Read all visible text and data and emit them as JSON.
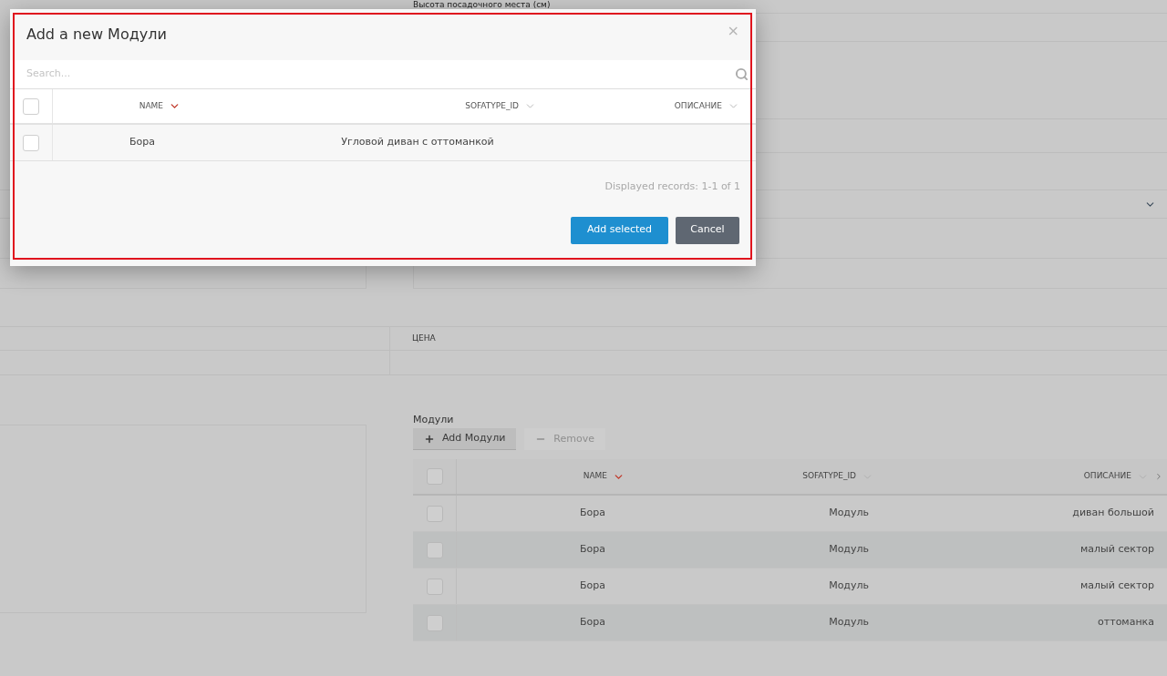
{
  "form": {
    "top_label": "Высота посадочного места (см)",
    "price_column": "ЦЕНА"
  },
  "modules": {
    "label": "Модули",
    "buttons": [
      {
        "kind": "add",
        "label": "Add Модули",
        "disabled": false
      },
      {
        "kind": "remove",
        "label": "Remove",
        "disabled": true
      }
    ],
    "select_all_checked": false,
    "columns": [
      {
        "label": "NAME",
        "sorted": true
      },
      {
        "label": "SOFATYPE_ID",
        "sorted": false
      },
      {
        "label": "ОПИСАНИЕ",
        "sorted": false
      }
    ],
    "rows": [
      {
        "checked": false,
        "cells": [
          "Бора",
          "Модуль",
          "диван большой"
        ]
      },
      {
        "checked": false,
        "cells": [
          "Бора",
          "Модуль",
          "малый сектор"
        ]
      },
      {
        "checked": false,
        "cells": [
          "Бора",
          "Модуль",
          "малый сектор"
        ]
      },
      {
        "checked": false,
        "cells": [
          "Бора",
          "Модуль",
          "оттоманка"
        ]
      }
    ]
  },
  "dialog": {
    "title": "Add a new Модули",
    "close": "×",
    "search": {
      "placeholder": "Search..."
    },
    "select_all_checked": false,
    "columns": [
      {
        "label": "NAME",
        "sorted": true
      },
      {
        "label": "SOFATYPE_ID",
        "sorted": false
      },
      {
        "label": "ОПИСАНИЕ",
        "sorted": false
      }
    ],
    "rows": [
      {
        "checked": false,
        "cells": [
          "Бора",
          "Угловой диван с оттоманкой",
          ""
        ]
      }
    ],
    "records": "Displayed records: 1-1 of 1",
    "buttons": [
      {
        "kind": "primary",
        "label": "Add selected"
      },
      {
        "kind": "secondary",
        "label": "Cancel"
      }
    ]
  }
}
